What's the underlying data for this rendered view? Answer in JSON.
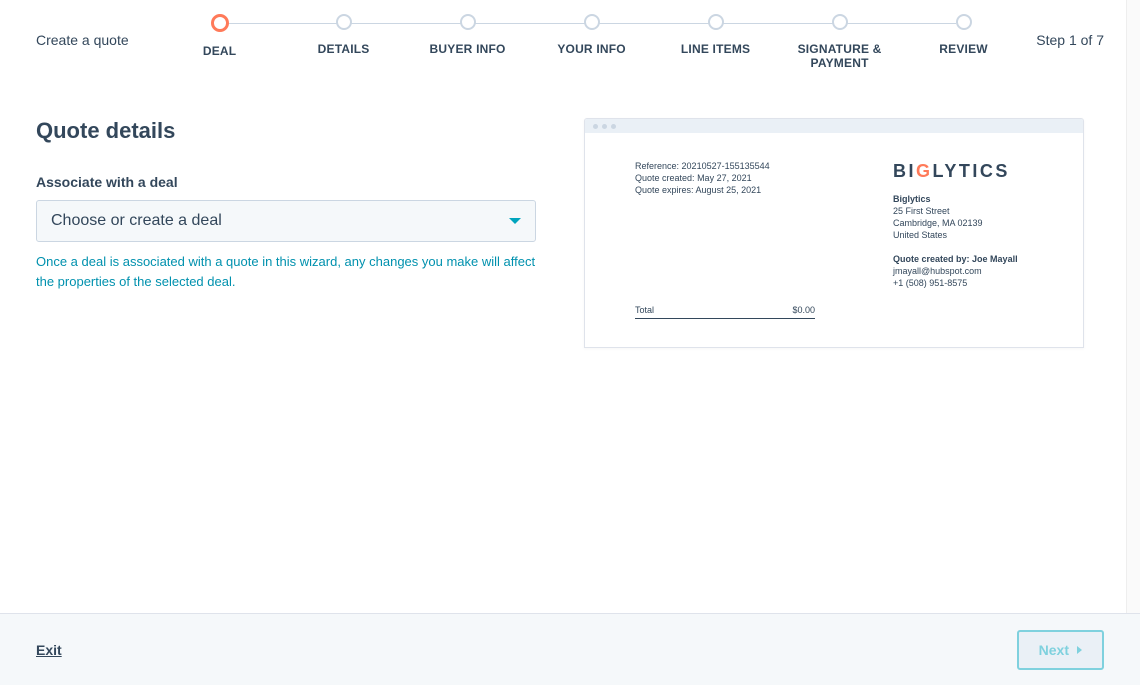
{
  "header": {
    "title": "Create a quote",
    "step_counter": "Step 1 of 7"
  },
  "stepper": {
    "steps": [
      {
        "label": "DEAL",
        "active": true
      },
      {
        "label": "DETAILS",
        "active": false
      },
      {
        "label": "BUYER INFO",
        "active": false
      },
      {
        "label": "YOUR INFO",
        "active": false
      },
      {
        "label": "LINE ITEMS",
        "active": false
      },
      {
        "label": "SIGNATURE & PAYMENT",
        "active": false
      },
      {
        "label": "REVIEW",
        "active": false
      }
    ]
  },
  "form": {
    "section_title": "Quote details",
    "deal_label": "Associate with a deal",
    "deal_placeholder": "Choose or create a deal",
    "help_text": "Once a deal is associated with a quote in this wizard, any changes you make will affect the properties of the selected deal."
  },
  "preview": {
    "reference_label": "Reference:",
    "reference_value": "20210527-155135544",
    "created_label": "Quote created:",
    "created_value": "May 27, 2021",
    "expires_label": "Quote expires:",
    "expires_value": "August 25, 2021",
    "logo_text_1": "BI",
    "logo_text_2": "G",
    "logo_text_3": "LYTICS",
    "company_name": "Biglytics",
    "address_line1": "25 First Street",
    "address_line2": "Cambridge, MA 02139",
    "address_country": "United States",
    "created_by_label": "Quote created by:",
    "created_by_name": "Joe Mayall",
    "email": "jmayall@hubspot.com",
    "phone": "+1 (508) 951-8575",
    "total_label": "Total",
    "total_value": "$0.00"
  },
  "footer": {
    "exit_label": "Exit",
    "next_label": "Next"
  }
}
